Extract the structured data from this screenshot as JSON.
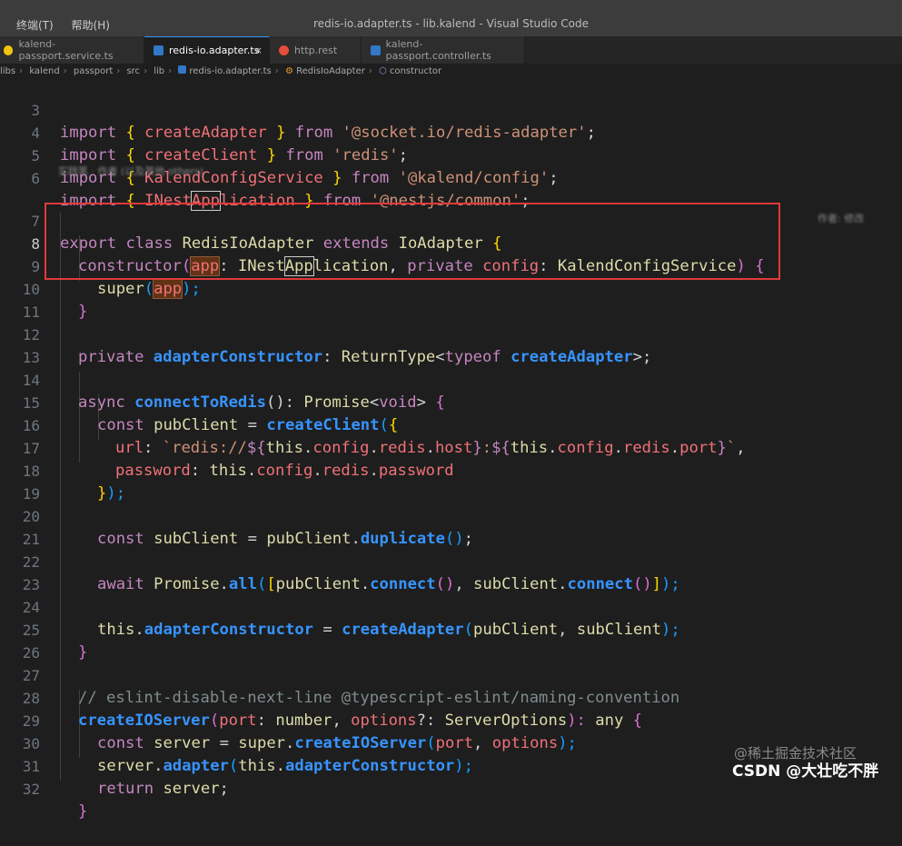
{
  "menu": {
    "terminal": "终端(T)",
    "help": "帮助(H)"
  },
  "window_title": "redis-io.adapter.ts - lib.kalend - Visual Studio Code",
  "tabs": [
    {
      "label": "kalend-passport.service.ts",
      "icon": "angular-service-icon",
      "color": "#f1c40f"
    },
    {
      "label": "redis-io.adapter.ts",
      "icon": "typescript-file-icon",
      "color": "#3178c6",
      "close": "×"
    },
    {
      "label": "http.rest",
      "icon": "http-file-icon",
      "color": "#e74c3c"
    },
    {
      "label": "kalend-passport.controller.ts",
      "icon": "typescript-file-icon",
      "color": "#3178c6"
    }
  ],
  "breadcrumb": [
    "libs",
    "kalend",
    "passport",
    "src",
    "lib",
    "redis-io.adapter.ts",
    "RedisIoAdapter",
    "constructor"
  ],
  "line_numbers": [
    "3",
    "4",
    "5",
    "6",
    "7",
    "8",
    "9",
    "10",
    "11",
    "12",
    "13",
    "14",
    "15",
    "16",
    "17",
    "18",
    "19",
    "20",
    "21",
    "22",
    "23",
    "24",
    "25",
    "26",
    "27",
    "28",
    "29",
    "30",
    "31",
    "32"
  ],
  "current_line": "8",
  "blame_text": "实践笔 · 作者 (以及其他 others)",
  "ghost_text": "作者: 修改",
  "code": {
    "l3": [
      "import",
      "{",
      "createAdapter",
      "}",
      "from",
      "'@socket.io/redis-adapter'",
      ";"
    ],
    "l4": [
      "import",
      "{",
      "createClient",
      "}",
      "from",
      "'redis'",
      ";"
    ],
    "l5": [
      "import",
      "{",
      "KalendConfigService",
      "}",
      "from",
      "'@kalend/config'",
      ";"
    ],
    "l6": [
      "import",
      "{",
      "INest",
      "App",
      "lication",
      "}",
      "from",
      "'@nestjs/common'",
      ";"
    ],
    "l7": [
      "export",
      "class",
      "RedisIoAdapter",
      "extends",
      "IoAdapter",
      "{"
    ],
    "l8": [
      "constructor",
      "(",
      "app",
      ":",
      "INest",
      "App",
      "lication",
      ",",
      "private",
      "config",
      ":",
      "KalendConfigService",
      ")",
      "{"
    ],
    "l9": [
      "super",
      "(",
      "app",
      ");"
    ],
    "l10": [
      "}"
    ],
    "l12": [
      "private",
      "adapterConstructor",
      ":",
      "ReturnType",
      "<",
      "typeof",
      "createAdapter",
      ">;"
    ],
    "l14": [
      "async",
      "connectToRedis",
      "():",
      "Promise",
      "<",
      "void",
      ">",
      "{"
    ],
    "l15": [
      "const",
      "pubClient",
      "=",
      "createClient",
      "(",
      "{"
    ],
    "l16": [
      "url",
      ":",
      "`redis://",
      "${",
      "this",
      ".",
      "config",
      ".",
      "redis",
      ".",
      "host",
      "}",
      ":",
      "${",
      "this",
      ".",
      "config",
      ".",
      "redis",
      ".",
      "port",
      "}",
      "`",
      ","
    ],
    "l17": [
      "password",
      ":",
      "this",
      ".",
      "config",
      ".",
      "redis",
      ".",
      "password"
    ],
    "l18": [
      "}",
      ");"
    ],
    "l20": [
      "const",
      "subClient",
      "=",
      "pubClient",
      ".",
      "duplicate",
      "()",
      ";"
    ],
    "l22": [
      "await",
      "Promise",
      ".",
      "all",
      "(",
      "[",
      "pubClient",
      ".",
      "connect",
      "()",
      ",",
      "subClient",
      ".",
      "connect",
      "()",
      "]",
      ");"
    ],
    "l24": [
      "this",
      ".",
      "adapterConstructor",
      "=",
      "createAdapter",
      "(",
      "pubClient",
      ",",
      "subClient",
      ");"
    ],
    "l25": [
      "}"
    ],
    "l27": [
      "// eslint-disable-next-line @typescript-eslint/naming-convention"
    ],
    "l28": [
      "createIOServer",
      "(",
      "port",
      ":",
      "number",
      ",",
      "options",
      "?:",
      "ServerOptions",
      "):",
      "any",
      "{"
    ],
    "l29": [
      "const",
      "server",
      "=",
      "super",
      ".",
      "createIOServer",
      "(",
      "port",
      ",",
      "options",
      ");"
    ],
    "l30": [
      "server",
      ".",
      "adapter",
      "(",
      "this",
      ".",
      "adapterConstructor",
      ");"
    ],
    "l31": [
      "return",
      "server",
      ";"
    ],
    "l32": [
      "}"
    ]
  },
  "watermark": {
    "line1": "@稀土掘金技术社区",
    "line2": "CSDN @大壮吃不胖"
  }
}
